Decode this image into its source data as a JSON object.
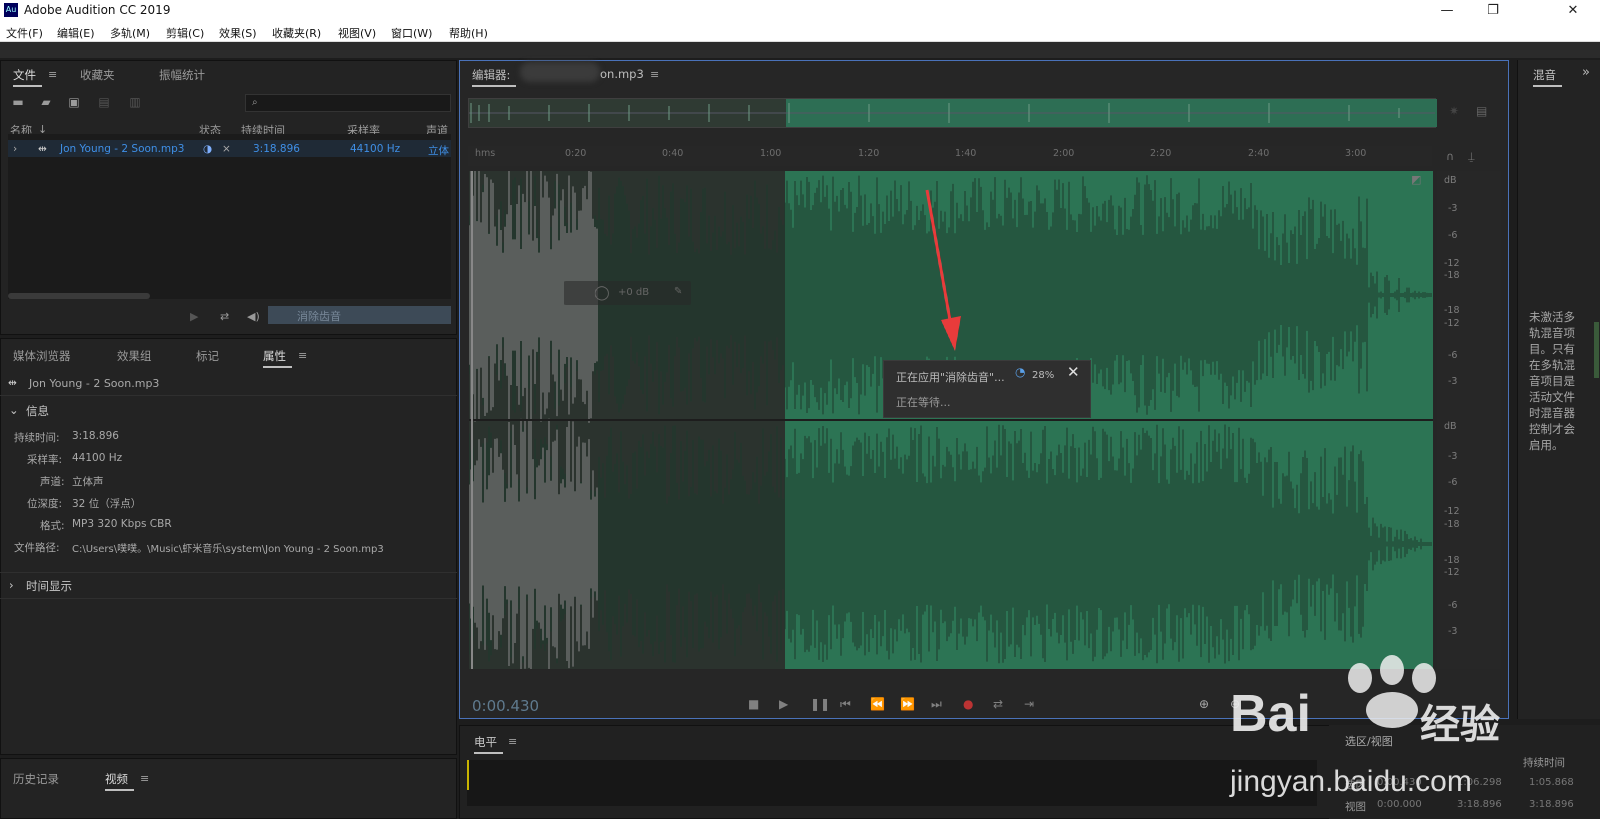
{
  "window": {
    "app_icon": "Au",
    "title": "Adobe Audition CC 2019",
    "minimize": "—",
    "restore": "❐",
    "close": "✕"
  },
  "menu": [
    "文件(F)",
    "编辑(E)",
    "多轨(M)",
    "剪辑(C)",
    "效果(S)",
    "收藏夹(R)",
    "视图(V)",
    "窗口(W)",
    "帮助(H)"
  ],
  "files_panel": {
    "tabs": [
      "文件",
      "收藏夹",
      "振幅统计"
    ],
    "columns": [
      "名称",
      "状态",
      "持续时间",
      "采样率",
      "声道"
    ],
    "file": {
      "name": "Jon Young - 2 Soon.mp3",
      "duration": "3:18.896",
      "sample_rate": "44100 Hz",
      "channels": "立体"
    },
    "effect_button": "消除齿音"
  },
  "props_panel": {
    "tabs": [
      "媒体浏览器",
      "效果组",
      "标记",
      "属性"
    ],
    "file_name": "Jon Young - 2 Soon.mp3",
    "section_info": "信息",
    "info": [
      {
        "label": "持续时间:",
        "value": "3:18.896"
      },
      {
        "label": "采样率:",
        "value": "44100 Hz"
      },
      {
        "label": "声道:",
        "value": "立体声"
      },
      {
        "label": "位深度:",
        "value": "32 位（浮点）"
      },
      {
        "label": "格式:",
        "value": "MP3 320 Kbps CBR"
      },
      {
        "label": "文件路径:",
        "value": "C:\\Users\\噗噗。\\Music\\虾米音乐\\system\\Jon Young - 2 Soon.mp3"
      }
    ],
    "section_time": "时间显示"
  },
  "history_panel": {
    "tabs": [
      "历史记录",
      "视频"
    ]
  },
  "editor": {
    "tab_label": "编辑器:",
    "tab_file": "on.mp3",
    "ruler_ticks": [
      "hms",
      "0:20",
      "0:40",
      "1:00",
      "1:20",
      "1:40",
      "2:00",
      "2:20",
      "2:40",
      "3:00"
    ],
    "hud_gain": "+0 dB",
    "timecode": "0:00.430",
    "db_top": [
      "dB",
      "-3",
      "-6",
      "-12",
      "-18",
      "-18",
      "-12",
      "-6",
      "-3"
    ],
    "db_bottom": [
      "dB",
      "-3",
      "-6",
      "-12",
      "-18",
      "-18",
      "-12",
      "-6",
      "-3"
    ],
    "selection_color": "#2c7454"
  },
  "popup": {
    "applying": "正在应用\"消除齿音\"...",
    "percent": "28%",
    "waiting": "正在等待..."
  },
  "level_panel": {
    "title": "电平"
  },
  "selection_panel": {
    "title": "选区/视图",
    "col_duration": "持续时间",
    "rows": [
      {
        "label": "选区",
        "start": "0:00.430",
        "end": "1:06.298",
        "duration": "1:05.868"
      },
      {
        "label": "视图",
        "start": "0:00.000",
        "end": "3:18.896",
        "duration": "3:18.896"
      }
    ]
  },
  "mixer": {
    "title": "混音",
    "message": "未激活多轨混音项目。只有在多轨混音项目是活动文件时混音器控制才会启用。"
  },
  "watermark": {
    "brand": "Bai",
    "brand2": "经验",
    "url": "jingyan.baidu.com"
  }
}
